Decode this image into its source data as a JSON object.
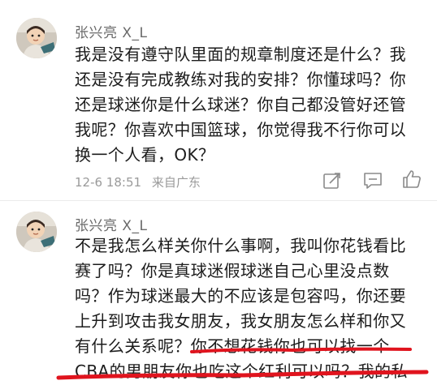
{
  "comments": [
    {
      "username": "张兴亮 X_L",
      "lines": [
        "我是没有遵守队里面的规章制度还是什么？我",
        "还是没有完成教练对我的安排？你懂球吗？你",
        "还是球迷你是什么球迷？你自己都没管好还管",
        "我呢？你喜欢中国篮球，你觉得我不行你可以",
        "换一个人看，OK？"
      ],
      "time": "12-6 18:51",
      "location": "来自广东",
      "icons": [
        "share-icon",
        "comment-icon",
        "like-icon"
      ]
    },
    {
      "username": "张兴亮 X_L",
      "lines": [
        "不是我怎么样关你什么事啊，我叫你花钱看比",
        "赛了吗？你是真球迷假球迷自己心里没点数",
        "吗？作为球迷最大的不应该是包容吗，你还要",
        "上升到攻击我女朋友，我女朋友怎么样和你又",
        "有什么关系呢？你不想花钱你也可以找一个",
        "CBA的男朋友你也吃这个红利可以吗？我的私"
      ]
    }
  ],
  "colors": {
    "underline": "#e0141e",
    "meta_text": "#9a9a9a",
    "username": "#6a6a6a"
  }
}
